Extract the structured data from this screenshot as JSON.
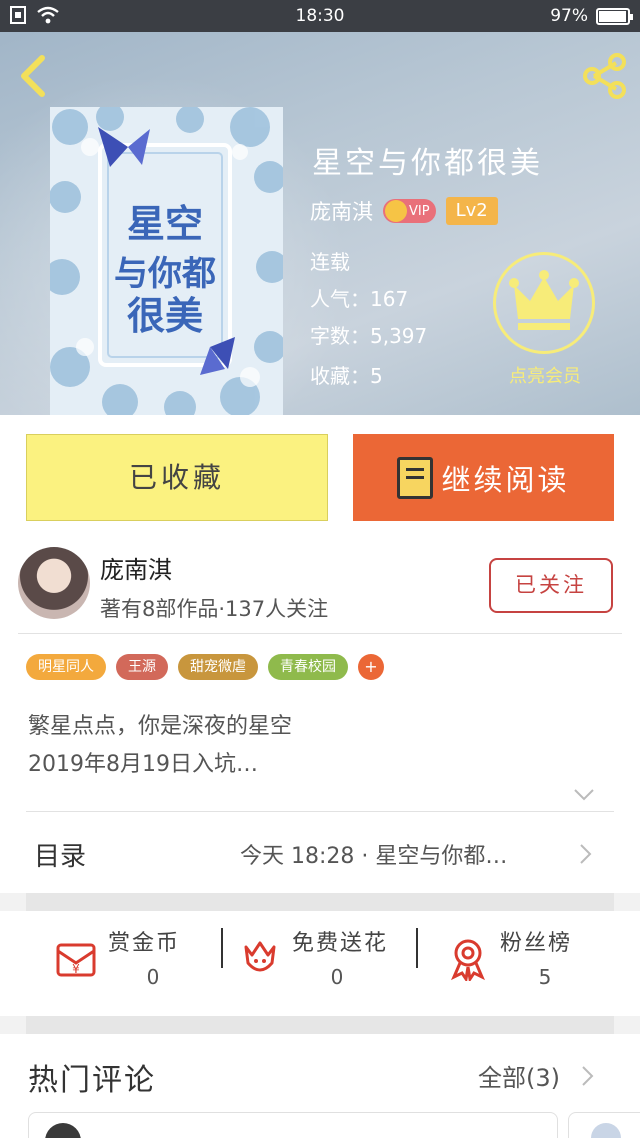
{
  "status_bar": {
    "time": "18:30",
    "battery": "97%",
    "battery_level": 0.97
  },
  "book": {
    "title": "星空与你都很美",
    "author": "庞南淇",
    "vip_label": "VIP",
    "level": "Lv2",
    "status": "连载",
    "popularity": "人气：167",
    "word_count": "字数：5,397",
    "favorites": "收藏：5",
    "cover_text": "星空与你都很美"
  },
  "member": {
    "label": "点亮会员"
  },
  "actions": {
    "favorited_label": "已收藏",
    "continue_label": "继续阅读"
  },
  "author_card": {
    "name": "庞南淇",
    "desc": "著有8部作品·137人关注",
    "follow_label": "已关注"
  },
  "tags": [
    {
      "label": "明星同人",
      "color": "#f3a93d"
    },
    {
      "label": "王源",
      "color": "#d2695a"
    },
    {
      "label": "甜宠微虐",
      "color": "#c8963d"
    },
    {
      "label": "青春校园",
      "color": "#8fba4c"
    }
  ],
  "tag_more": "+",
  "intro": {
    "line1": "繁星点点，你是深夜的星空",
    "line2": "2019年8月19日入坑…"
  },
  "toc": {
    "label": "目录",
    "latest": "今天 18:28 · 星空与你都…"
  },
  "stats": [
    {
      "label": "赏金币",
      "value": "0"
    },
    {
      "label": "免费送花",
      "value": "0"
    },
    {
      "label": "粉丝榜",
      "value": "5"
    }
  ],
  "comments": {
    "title": "热门评论",
    "all_label": "全部(3)"
  },
  "colors": {
    "accent_orange": "#eb6736",
    "fav_yellow": "#fbf280",
    "follow_red": "#c64341",
    "member_yellow": "#f7ec79"
  }
}
